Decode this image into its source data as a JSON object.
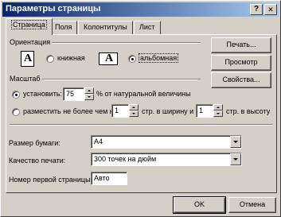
{
  "window": {
    "title": "Параметры страницы",
    "help_glyph": "?",
    "close_glyph": "✕"
  },
  "tabs": [
    "Страница",
    "Поля",
    "Колонтитулы",
    "Лист"
  ],
  "orientation": {
    "group_label": "Ориентация",
    "portrait_label": "книжная",
    "landscape_label": "альбомная",
    "icon_glyph": "A",
    "selected": "landscape"
  },
  "scale": {
    "group_label": "Масштаб",
    "adjust_label": "установить:",
    "adjust_value": "75",
    "adjust_suffix": "% от натуральной величины",
    "fit_label": "разместить не более чем на:",
    "fit_wide_value": "1",
    "fit_wide_suffix": "стр. в ширину и",
    "fit_tall_value": "1",
    "fit_tall_suffix": "стр. в высоту",
    "selected": "adjust"
  },
  "paper_size": {
    "label": "Размер бумаги:",
    "value": "A4"
  },
  "print_quality": {
    "label": "Качество печати:",
    "value": "300 точек на дюйм"
  },
  "first_page": {
    "label": "Номер первой страницы:",
    "value": "Авто"
  },
  "side_buttons": {
    "print": "Печать...",
    "preview": "Просмотр",
    "properties": "Свойства..."
  },
  "footer": {
    "ok": "OK",
    "cancel": "Отмена"
  }
}
